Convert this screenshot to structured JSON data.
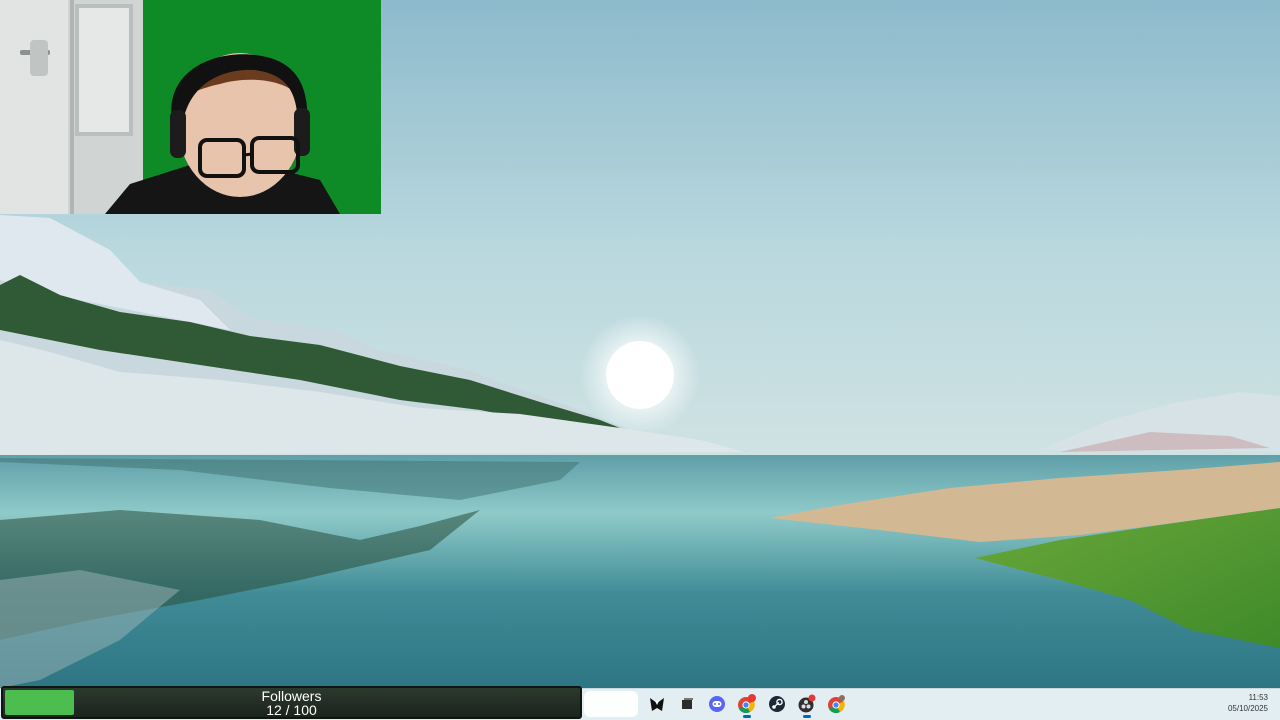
{
  "followers_widget": {
    "label": "Followers",
    "count_text": "12 / 100",
    "current": 12,
    "goal": 100,
    "fill_color": "#4cbe4f"
  },
  "taskbar": {
    "icons": [
      {
        "name": "start-menu-button"
      },
      {
        "name": "tuxedo-mask-icon"
      },
      {
        "name": "task-view-icon"
      },
      {
        "name": "discord-icon"
      },
      {
        "name": "chrome-icon-with-badge"
      },
      {
        "name": "steam-icon"
      },
      {
        "name": "obs-studio-icon"
      },
      {
        "name": "chrome-icon"
      }
    ],
    "clock": {
      "time": "11:53",
      "date": "05/10/2025"
    }
  },
  "wallpaper": {
    "scene": "lake-sunrise",
    "sky_color": "#a9cfd9",
    "water_color": "#3f8b96"
  },
  "webcam": {
    "background_color": "#0b7a1e"
  }
}
